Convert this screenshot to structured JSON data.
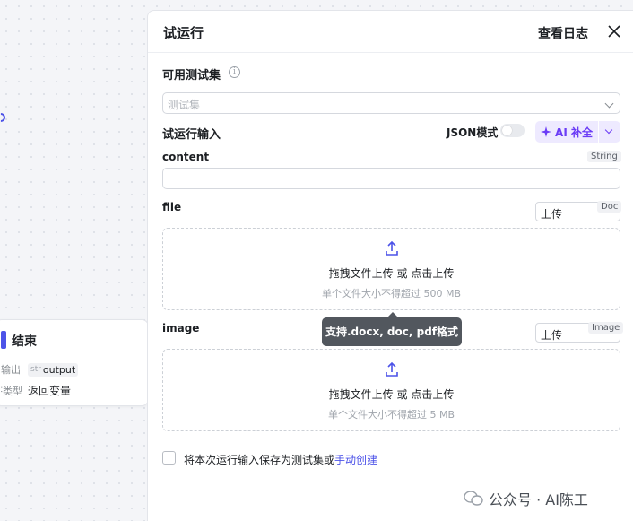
{
  "canvas": {
    "end_node": {
      "title": "结束",
      "output_label": "输出",
      "output_type": "str",
      "output_name": "output",
      "answer_type_label": "回答类型",
      "answer_type_value": "返回变量"
    }
  },
  "panel": {
    "title": "试运行",
    "view_logs": "查看日志",
    "testset_label": "可用测试集",
    "testset_placeholder": "测试集",
    "input_label": "试运行输入",
    "json_mode_label": "JSON模式",
    "ai_fill_label": "AI 补全",
    "fields": {
      "content": {
        "name": "content",
        "type": "String"
      },
      "file": {
        "name": "file",
        "type": "Doc",
        "mode": "上传",
        "upload_main": "拖拽文件上传",
        "upload_or": " 或 ",
        "upload_click": "点击上传",
        "upload_limit": "单个文件大小不得超过 500 MB"
      },
      "image": {
        "name": "image",
        "type": "Image",
        "mode": "上传",
        "upload_main": "拖拽文件上传",
        "upload_or": " 或 ",
        "upload_click": "点击上传",
        "upload_limit": "单个文件大小不得超过 5 MB"
      }
    },
    "tooltip": "支持.docx, doc, pdf格式",
    "save_text": "将本次运行输入保存为测试集或",
    "save_link": "手动创建"
  },
  "watermark": "公众号 · AI陈工",
  "colors": {
    "accent": "#4d53e8",
    "ai_purple": "#6b3cf6"
  }
}
